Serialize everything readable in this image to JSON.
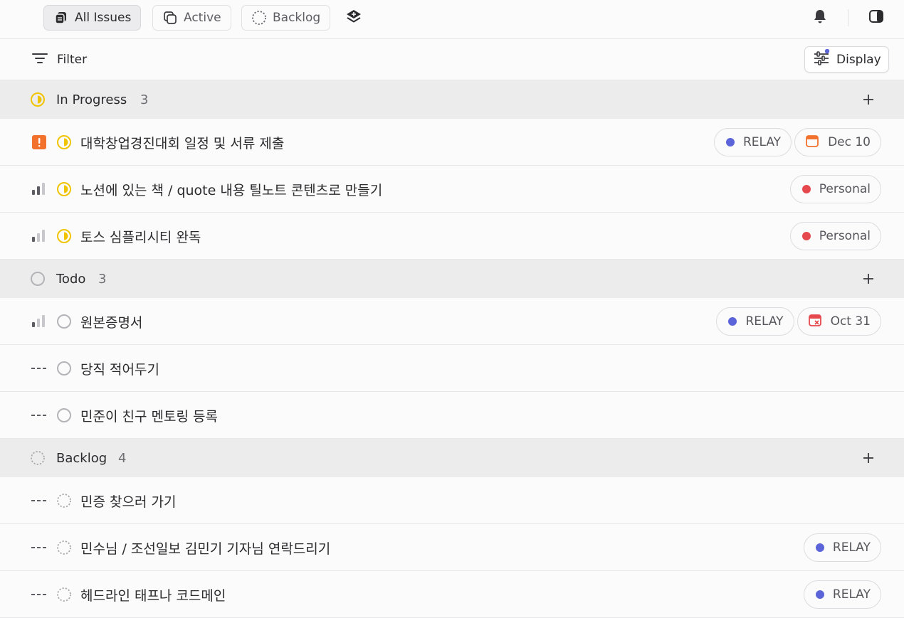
{
  "topbar": {
    "tabs": [
      {
        "label": "All Issues",
        "active": true
      },
      {
        "label": "Active",
        "active": false
      },
      {
        "label": "Backlog",
        "active": false
      }
    ]
  },
  "filterbar": {
    "filter_label": "Filter",
    "display_label": "Display"
  },
  "colors": {
    "in_progress": "#f0c400",
    "todo": "#b4b4b8",
    "urgent": "#f2712d",
    "relay_dot": "#5b64d8",
    "personal_dot": "#e5484d",
    "date_orange": "#f2712d",
    "date_overdue": "#e5484d"
  },
  "groups": [
    {
      "name": "In Progress",
      "count": "3",
      "status": "in-progress",
      "issues": [
        {
          "title": "대학창업경진대회 일정 및 서류 제출",
          "priority": "urgent",
          "label": "RELAY",
          "label_color": "#5b64d8",
          "date": "Dec 10",
          "date_state": "upcoming"
        },
        {
          "title": "노션에 있는 책 / quote 내용 틸노트 콘텐츠로 만들기",
          "priority": "medium",
          "label": "Personal",
          "label_color": "#e5484d"
        },
        {
          "title": "토스 심플리시티 완독",
          "priority": "low",
          "label": "Personal",
          "label_color": "#e5484d"
        }
      ]
    },
    {
      "name": "Todo",
      "count": "3",
      "status": "todo",
      "issues": [
        {
          "title": "원본증명서",
          "priority": "low",
          "label": "RELAY",
          "label_color": "#5b64d8",
          "date": "Oct 31",
          "date_state": "overdue"
        },
        {
          "title": "당직 적어두기",
          "priority": "none"
        },
        {
          "title": "민준이 친구 멘토링 등록",
          "priority": "none"
        }
      ]
    },
    {
      "name": "Backlog",
      "count": "4",
      "status": "backlog",
      "issues": [
        {
          "title": "민증 찾으러 가기",
          "priority": "none"
        },
        {
          "title": "민수님 / 조선일보 김민기 기자님 연락드리기",
          "priority": "none",
          "label": "RELAY",
          "label_color": "#5b64d8"
        },
        {
          "title": "헤드라인 태프나 코드메인",
          "priority": "none",
          "label": "RELAY",
          "label_color": "#5b64d8"
        }
      ]
    }
  ]
}
